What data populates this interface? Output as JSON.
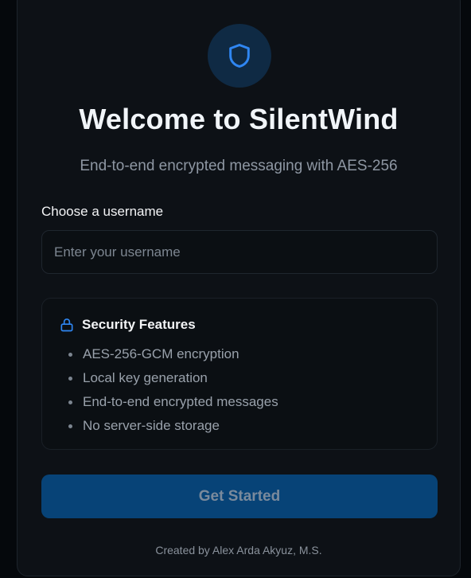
{
  "header": {
    "icon": "shield-icon",
    "title": "Welcome to SilentWind",
    "subtitle": "End-to-end encrypted messaging with AES-256"
  },
  "form": {
    "username_label": "Choose a username",
    "username_placeholder": "Enter your username",
    "username_value": ""
  },
  "security": {
    "icon": "lock-icon",
    "title": "Security Features",
    "items": [
      "AES-256-GCM encryption",
      "Local key generation",
      "End-to-end encrypted messages",
      "No server-side storage"
    ]
  },
  "actions": {
    "submit_label": "Get Started",
    "submit_state": "disabled"
  },
  "footer": {
    "credit": "Created by Alex Arda Akyuz, M.S."
  },
  "colors": {
    "accent": "#3b82f6",
    "button_bg": "#074377",
    "card_bg": "#0d1116",
    "page_bg": "#05080c"
  }
}
